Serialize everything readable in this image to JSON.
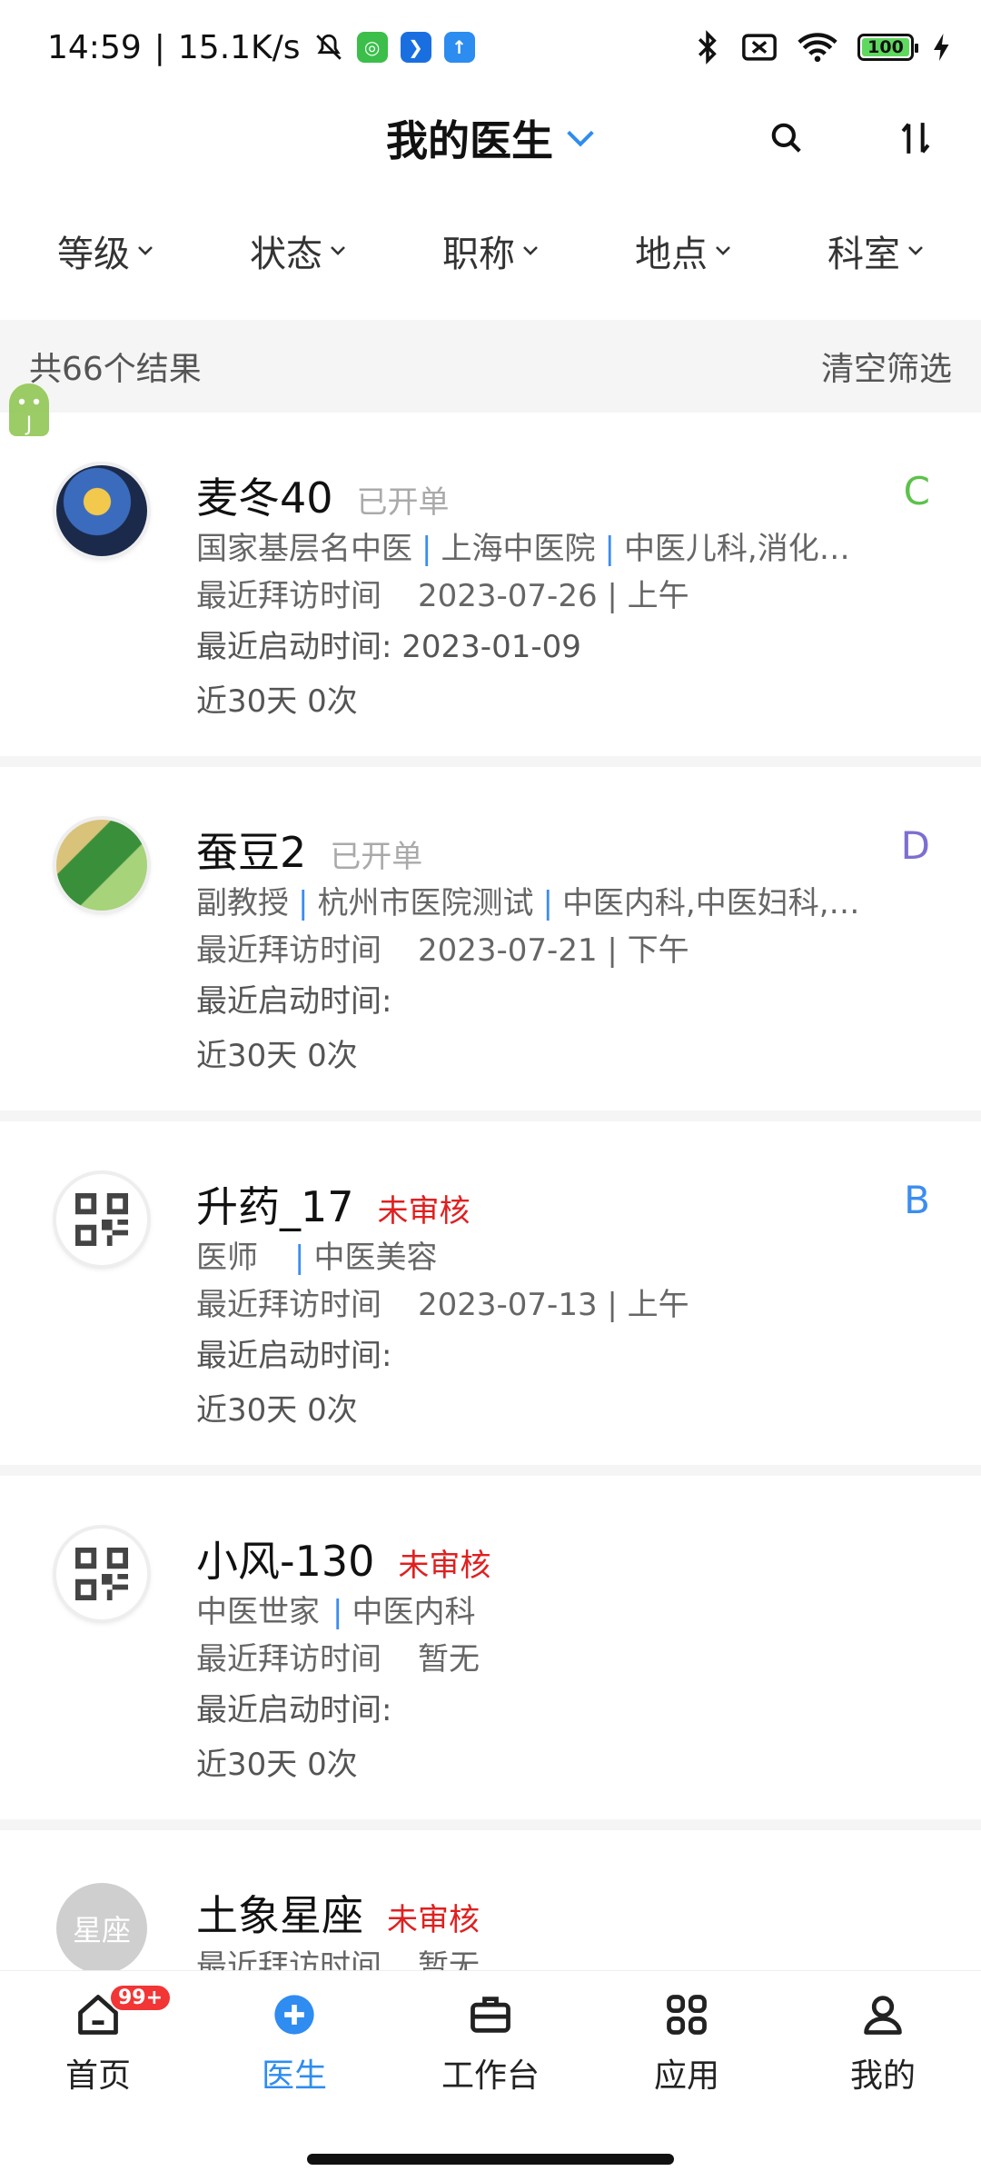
{
  "status_bar": {
    "time": "14:59",
    "speed": "15.1K/s",
    "battery": "100"
  },
  "header": {
    "title": "我的医生"
  },
  "filters": [
    "等级",
    "状态",
    "职称",
    "地点",
    "科室"
  ],
  "results": {
    "count_text": "共66个结果",
    "clear_label": "清空筛选"
  },
  "doctors": [
    {
      "name": "麦冬40",
      "status": "已开单",
      "status_color": "gray",
      "level": "C",
      "level_color": "#5cc24a",
      "info": [
        "国家基层名中医",
        "上海中医院",
        "中医儿科,消化…"
      ],
      "visit_label": "最近拜访时间",
      "visit_value": "2023-07-26 | 上午",
      "start_label": "最近启动时间:",
      "start_value": "2023-01-09",
      "recent_label": "近30天",
      "recent_value": "0次"
    },
    {
      "name": "蚕豆2",
      "status": "已开单",
      "status_color": "gray",
      "level": "D",
      "level_color": "#7c6fd1",
      "info": [
        "副教授",
        "杭州市医院测试",
        "中医内科,中医妇科,…"
      ],
      "visit_label": "最近拜访时间",
      "visit_value": "2023-07-21 | 下午",
      "start_label": "最近启动时间:",
      "start_value": "",
      "recent_label": "近30天",
      "recent_value": "0次"
    },
    {
      "name": "升药_17",
      "status": "未审核",
      "status_color": "red",
      "level": "B",
      "level_color": "#3c8df0",
      "info": [
        "医师",
        "中医美容"
      ],
      "visit_label": "最近拜访时间",
      "visit_value": "2023-07-13 | 上午",
      "start_label": "最近启动时间:",
      "start_value": "",
      "recent_label": "近30天",
      "recent_value": "0次"
    },
    {
      "name": "小风-130",
      "status": "未审核",
      "status_color": "red",
      "level": "",
      "level_color": "#3c8df0",
      "info": [
        "中医世家",
        "中医内科"
      ],
      "visit_label": "最近拜访时间",
      "visit_value": "暂无",
      "start_label": "最近启动时间:",
      "start_value": "",
      "recent_label": "近30天",
      "recent_value": "0次"
    },
    {
      "name": "土象星座",
      "status": "未审核",
      "status_color": "red",
      "level": "",
      "level_color": "#3c8df0",
      "avatar_text": "星座",
      "info": [],
      "visit_label": "最近拜访时间",
      "visit_value": "暂无",
      "start_label": "",
      "start_value": "",
      "recent_label": "",
      "recent_value": ""
    }
  ],
  "tabbar": {
    "items": [
      {
        "label": "首页",
        "icon": "home-icon",
        "badge": "99+"
      },
      {
        "label": "医生",
        "icon": "doctor-plus-icon",
        "active": true
      },
      {
        "label": "工作台",
        "icon": "briefcase-icon"
      },
      {
        "label": "应用",
        "icon": "apps-grid-icon"
      },
      {
        "label": "我的",
        "icon": "user-icon"
      }
    ]
  },
  "colors": {
    "accent": "#2f8cf0",
    "red": "#e02020",
    "divider": "#f5f5f5"
  }
}
